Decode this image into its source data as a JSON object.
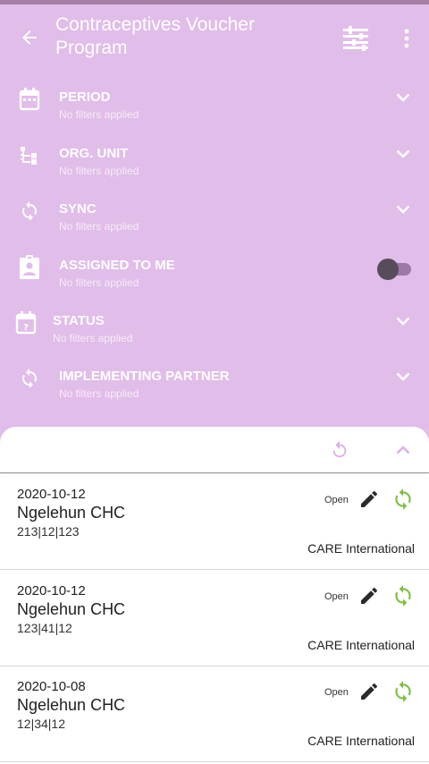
{
  "appbar": {
    "title": "Contraceptives Voucher Program",
    "back_icon": "arrow-back-icon",
    "filter_icon": "filter-sliders-icon",
    "more_icon": "more-vert-icon"
  },
  "filters": [
    {
      "label": "PERIOD",
      "subtitle": "No filters applied",
      "icon": "calendar-icon"
    },
    {
      "label": "ORG. UNIT",
      "subtitle": "No filters applied",
      "icon": "org-tree-icon"
    },
    {
      "label": "SYNC",
      "subtitle": "No filters applied",
      "icon": "sync-icon"
    },
    {
      "label": "ASSIGNED TO ME",
      "subtitle": "No filters applied",
      "icon": "assignment-ind-icon",
      "toggle_on": false
    },
    {
      "label": "STATUS",
      "subtitle": "No filters applied",
      "icon": "calendar-question-icon"
    },
    {
      "label": "IMPLEMENTING PARTNER",
      "subtitle": "No filters applied",
      "icon": "sync-icon"
    }
  ],
  "events": [
    {
      "date": "2020-10-12",
      "org_unit": "Ngelehun CHC",
      "option_combo": "213|12|123",
      "status": "Open",
      "partner": "CARE International"
    },
    {
      "date": "2020-10-12",
      "org_unit": "Ngelehun CHC",
      "option_combo": "123|41|12",
      "status": "Open",
      "partner": "CARE International"
    },
    {
      "date": "2020-10-08",
      "org_unit": "Ngelehun CHC",
      "option_combo": "12|34|12",
      "status": "Open",
      "partner": "CARE International"
    }
  ],
  "colors": {
    "header_bg": "#e1bde9",
    "top_strip": "#a57fa6",
    "sync_green": "#7cc142",
    "refresh_pink": "#dcb0e6",
    "edit_dark": "#2b2b2b"
  }
}
